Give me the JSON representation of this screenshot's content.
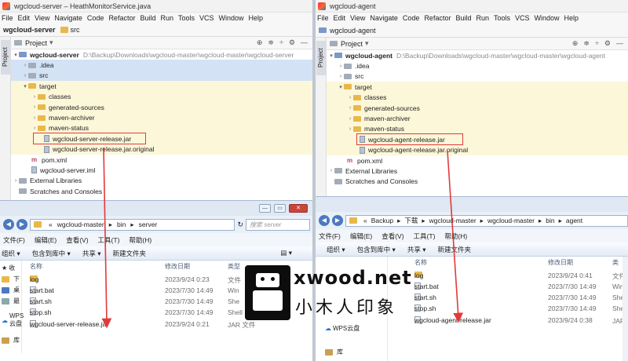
{
  "left": {
    "title": "wgcloud-server – HeathMonitorService.java",
    "menu": [
      "File",
      "Edit",
      "View",
      "Navigate",
      "Code",
      "Refactor",
      "Build",
      "Run",
      "Tools",
      "VCS",
      "Window",
      "Help"
    ],
    "breadcrumb": {
      "root": "wgcloud-server",
      "child": "src"
    },
    "side_tab": "Project",
    "panel_title": "Project",
    "tree": [
      {
        "label": "wgcloud-server",
        "path": "D:\\Backup\\Downloads\\wgcloud-master\\wgcloud-master\\wgcloud-server",
        "bold": true
      },
      {
        "label": ".idea"
      },
      {
        "label": "src"
      },
      {
        "label": "target"
      },
      {
        "label": "classes"
      },
      {
        "label": "generated-sources"
      },
      {
        "label": "maven-archiver"
      },
      {
        "label": "maven-status"
      },
      {
        "label": "wgcloud-server-release.jar"
      },
      {
        "label": "wgcloud-server-release.jar.original"
      },
      {
        "label": "pom.xml"
      },
      {
        "label": "wgcloud-server.iml"
      },
      {
        "label": "External Libraries"
      },
      {
        "label": "Scratches and Consoles"
      }
    ],
    "explorer": {
      "address": [
        "«",
        "wgcloud-master",
        "bin",
        "server"
      ],
      "search_placeholder": "搜索 server",
      "menu": [
        "文件(F)",
        "编辑(E)",
        "查看(V)",
        "工具(T)",
        "帮助(H)"
      ],
      "toolbar": [
        "组织",
        "包含到库中",
        "共享",
        "新建文件夹"
      ],
      "columns": [
        "名称",
        "修改日期",
        "类型"
      ],
      "nav": [
        "收",
        "下",
        "桌",
        "最",
        "WPS云盘",
        "库"
      ],
      "files": [
        {
          "name": "log",
          "date": "2023/9/24 0:23",
          "type": "文件",
          "kind": "dir"
        },
        {
          "name": "start.bat",
          "date": "2023/7/30 14:49",
          "type": "Win",
          "kind": "file"
        },
        {
          "name": "start.sh",
          "date": "2023/7/30 14:49",
          "type": "She",
          "kind": "file"
        },
        {
          "name": "stop.sh",
          "date": "2023/7/30 14:49",
          "type": "Shell Script",
          "kind": "file"
        },
        {
          "name": "wgcloud-server-release.jar",
          "date": "2023/9/24 0:21",
          "type": "JAR 文件",
          "kind": "file"
        }
      ]
    }
  },
  "right": {
    "title": "wgcloud-agent",
    "menu": [
      "File",
      "Edit",
      "View",
      "Navigate",
      "Code",
      "Refactor",
      "Build",
      "Run",
      "Tools",
      "VCS",
      "Window",
      "Help"
    ],
    "breadcrumb": {
      "root": "wgcloud-agent"
    },
    "side_tab": "Project",
    "panel_title": "Project",
    "tree": [
      {
        "label": "wgcloud-agent",
        "path": "D:\\Backup\\Downloads\\wgcloud-master\\wgcloud-master\\wgcloud-agent",
        "bold": true
      },
      {
        "label": ".idea"
      },
      {
        "label": "src"
      },
      {
        "label": "target"
      },
      {
        "label": "classes"
      },
      {
        "label": "generated-sources"
      },
      {
        "label": "maven-archiver"
      },
      {
        "label": "maven-status"
      },
      {
        "label": "wgcloud-agent-release.jar"
      },
      {
        "label": "wgcloud-agent-release.jar.original"
      },
      {
        "label": "pom.xml"
      },
      {
        "label": "External Libraries"
      },
      {
        "label": "Scratches and Consoles"
      }
    ],
    "explorer": {
      "address": [
        "«",
        "Backup",
        "下载",
        "wgcloud-master",
        "wgcloud-master",
        "bin",
        "agent"
      ],
      "menu": [
        "文件(F)",
        "编辑(E)",
        "查看(V)",
        "工具(T)",
        "帮助(H)"
      ],
      "toolbar": [
        "组织",
        "包含到库中",
        "共享",
        "新建文件夹"
      ],
      "columns": [
        "名称",
        "修改日期",
        "类"
      ],
      "nav": [
        "WPS云盘",
        "库"
      ],
      "files": [
        {
          "name": "log",
          "date": "2023/9/24 0:41",
          "type": "文件",
          "kind": "dir"
        },
        {
          "name": "start.bat",
          "date": "2023/7/30 14:49",
          "type": "Wind",
          "kind": "file"
        },
        {
          "name": "start.sh",
          "date": "2023/7/30 14:49",
          "type": "Shell",
          "kind": "file"
        },
        {
          "name": "stop.sh",
          "date": "2023/7/30 14:49",
          "type": "Shell",
          "kind": "file"
        },
        {
          "name": "wgcloud-agent-release.jar",
          "date": "2023/9/24 0:38",
          "type": "JAR 文",
          "kind": "file"
        }
      ]
    }
  },
  "watermark": {
    "brand": "xwood.net",
    "cn": "小木人印象"
  },
  "colors": {
    "highlight_box": "#e03b3b",
    "selection": "#d4e2f6",
    "folder": "#e8b84a"
  }
}
